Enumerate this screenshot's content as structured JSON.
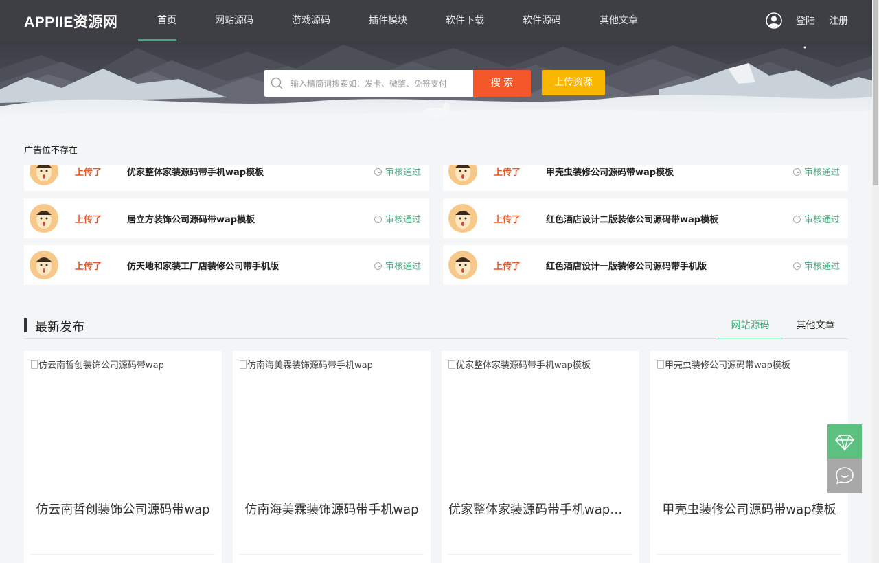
{
  "header": {
    "logo": "APPIIE资源网",
    "nav": [
      "首页",
      "网站源码",
      "游戏源码",
      "插件模块",
      "软件下载",
      "软件源码",
      "其他文章"
    ],
    "active_nav": "首页",
    "login": "登陆",
    "register": "注册"
  },
  "search": {
    "placeholder": "输入精简词搜索如：发卡、微擎、免签支付",
    "button": "搜 索",
    "upload_button": "上传资源"
  },
  "ad_text": "广告位不存在",
  "feed": {
    "action_label": "上传了",
    "status_label": "审核通过",
    "left": [
      "优家整体家装源码带手机wap模板",
      "居立方装饰公司源码带wap模板",
      "仿天地和家装工厂店装修公司带手机版"
    ],
    "right": [
      "甲壳虫装修公司源码带wap模板",
      "红色酒店设计二版装修公司源码带wap模板",
      "红色酒店设计一版装修公司源码带手机版"
    ]
  },
  "latest": {
    "title": "最新发布",
    "tabs": [
      "网站源码",
      "其他文章"
    ],
    "active_tab": "网站源码",
    "cards": [
      {
        "img_alt": "仿云南哲创装饰公司源码带wap",
        "title": "仿云南哲创装饰公司源码带wap"
      },
      {
        "img_alt": "仿南海美霖装饰源码带手机wap",
        "title": "仿南海美霖装饰源码带手机wap"
      },
      {
        "img_alt": "优家整体家装源码带手机wap模板",
        "title": "优家整体家装源码带手机wap模板"
      },
      {
        "img_alt": "甲壳虫装修公司源码带wap模板",
        "title": "甲壳虫装修公司源码带wap模板"
      }
    ]
  },
  "colors": {
    "header_bg": "#3d3f45",
    "accent_green": "#3fae7a",
    "search_orange": "#f3572a",
    "upload_yellow": "#f9b702",
    "uploaded_text": "#e45a2a"
  },
  "icons": [
    "user-icon",
    "search-icon",
    "clock-icon",
    "diamond-icon",
    "chat-icon"
  ]
}
